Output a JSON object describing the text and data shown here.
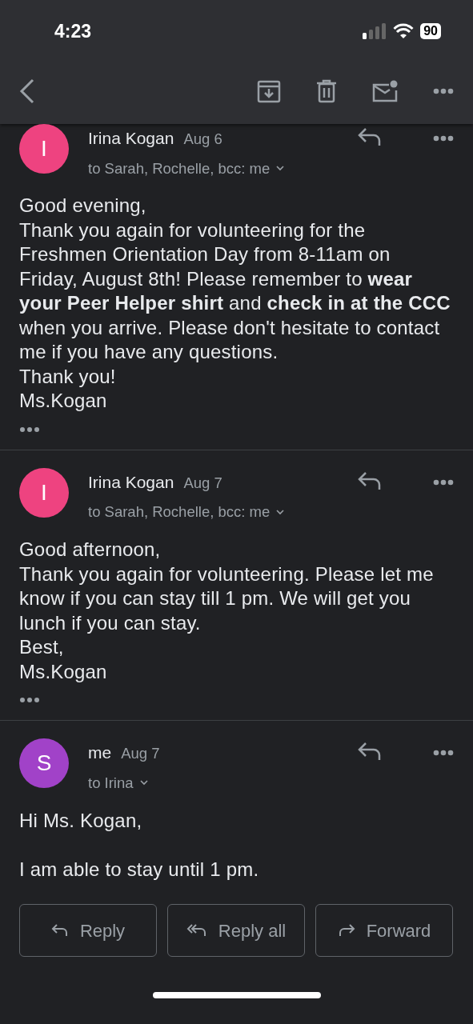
{
  "status_bar": {
    "time": "4:23",
    "battery": "90"
  },
  "toolbar": {
    "actions": [
      {
        "kind": "archive"
      },
      {
        "kind": "delete"
      },
      {
        "kind": "unread"
      },
      {
        "kind": "more"
      }
    ]
  },
  "messages": [
    {
      "initial": "I",
      "color": "#ee4380",
      "sender": "Irina Kogan",
      "date": "Aug 6",
      "recipients": "to Sarah, Rochelle, bcc: me",
      "body": [
        "Good evening,",
        "Thank you again for volunteering for the Freshmen Orientation Day from 8-11am on Friday, August 8th! Please remember to **wear your Peer Helper shirt** and **check in at the CCC** when you arrive. Please don't hesitate to contact me if you have any questions.",
        "Thank you!",
        "Ms.Kogan"
      ],
      "trimmed": true
    },
    {
      "initial": "I",
      "color": "#ee4380",
      "sender": "Irina Kogan",
      "date": "Aug 7",
      "recipients": "to Sarah, Rochelle, bcc: me",
      "body": [
        "Good afternoon,",
        "Thank you again for volunteering. Please let me know if you can stay till 1 pm. We will get you lunch if you can stay.",
        "Best,",
        "Ms.Kogan"
      ],
      "trimmed": true
    },
    {
      "initial": "S",
      "color": "#a142c8",
      "sender": "me",
      "date": "Aug 7",
      "recipients": "to Irina",
      "body": [
        "Hi Ms. Kogan,",
        "I am able to stay until 1 pm."
      ],
      "paragraph_gap": true,
      "trimmed": false
    }
  ],
  "actions": [
    {
      "kind": "reply",
      "label": "Reply"
    },
    {
      "kind": "reply_all",
      "label": "Reply all"
    },
    {
      "kind": "forward",
      "label": "Forward"
    }
  ]
}
